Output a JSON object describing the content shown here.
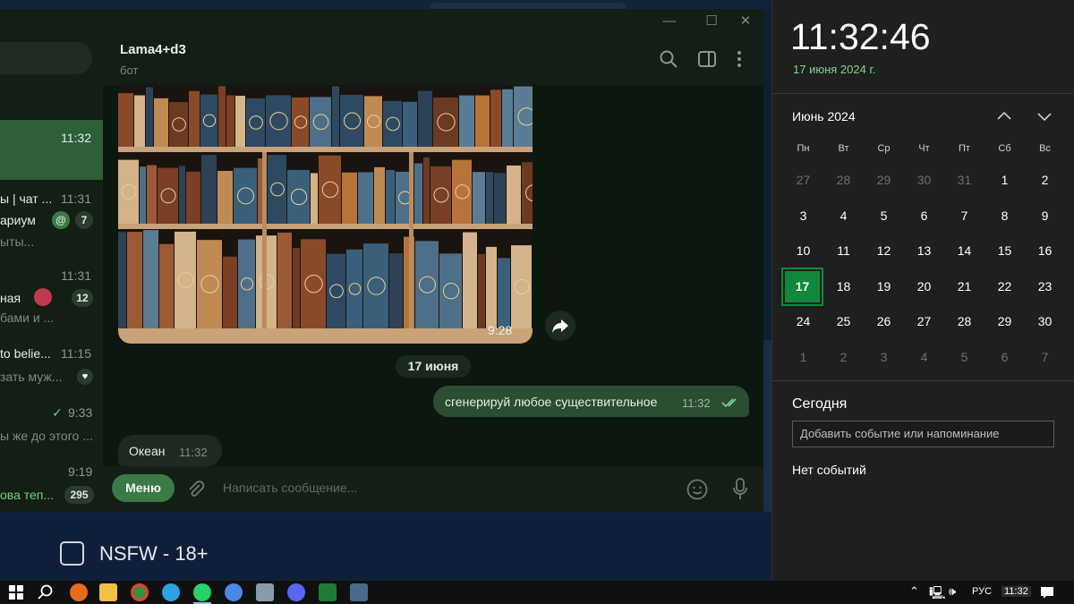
{
  "window": {
    "minimize": "—",
    "maximize": "☐",
    "close": "✕"
  },
  "sidebar": {
    "chats": [
      {
        "time": "11:32"
      },
      {
        "title": "ы | чат ...",
        "time": "11:31",
        "title2": "ариум",
        "mention": "@",
        "badge": "7",
        "sub": "ыты..."
      },
      {
        "title": "ная",
        "time": "11:31",
        "badge": "12",
        "sub": "бами и ..."
      },
      {
        "title": "to belie...",
        "time": "11:15",
        "sub": "зать муж..."
      },
      {
        "time": "9:33",
        "sub": "ы же до этого ..."
      },
      {
        "time": "9:19",
        "sub": "ова теп...",
        "badge": "295"
      }
    ]
  },
  "chat": {
    "title": "Lama4+d3",
    "subtitle": "бот",
    "image_time": "9:28",
    "date_separator": "17 июня",
    "messages": [
      {
        "direction": "out",
        "text": "сгенерируй любое существительное",
        "time": "11:32"
      },
      {
        "direction": "in",
        "text": "Океан",
        "time": "11:32"
      }
    ],
    "composer": {
      "menu_label": "Меню",
      "placeholder": "Написать сообщение..."
    }
  },
  "background": {
    "nsfw_label": "NSFW - 18+"
  },
  "calendar": {
    "clock": "11:32:46",
    "date": "17 июня 2024 г.",
    "month": "Июнь 2024",
    "weekdays": [
      "Пн",
      "Вт",
      "Ср",
      "Чт",
      "Пт",
      "Сб",
      "Вс"
    ],
    "days": [
      "27",
      "28",
      "29",
      "30",
      "31",
      "1",
      "2",
      "3",
      "4",
      "5",
      "6",
      "7",
      "8",
      "9",
      "10",
      "11",
      "12",
      "13",
      "14",
      "15",
      "16",
      "17",
      "18",
      "19",
      "20",
      "21",
      "22",
      "23",
      "24",
      "25",
      "26",
      "27",
      "28",
      "29",
      "30",
      "1",
      "2",
      "3",
      "4",
      "5",
      "6",
      "7"
    ],
    "today_label": "Сегодня",
    "event_placeholder": "Добавить событие или напоминание",
    "no_events": "Нет событий"
  },
  "taskbar": {
    "language": "РУС",
    "time": "11:32"
  },
  "colors": {
    "accent_green": "#10893e",
    "tg_selected": "#2d5f38",
    "tg_out_bubble": "#2b4d32"
  }
}
